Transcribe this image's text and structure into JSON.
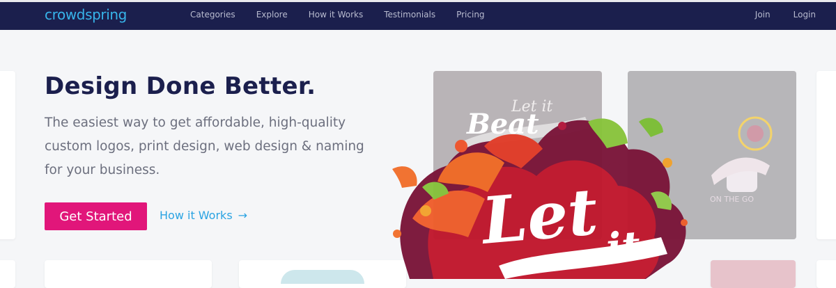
{
  "header": {
    "logo": "crowdspring",
    "nav": [
      "Categories",
      "Explore",
      "How it Works",
      "Testimonials",
      "Pricing"
    ],
    "join": "Join",
    "login": "Login"
  },
  "hero": {
    "title": "Design Done Better.",
    "subtitle": "The easiest way to get affordable, high-quality custom logos, print design, web design & naming for your business.",
    "cta": "Get Started",
    "secondary_link": "How it Works",
    "secondary_icon": "arrow-right-icon"
  },
  "gallery": {
    "artwork_text_1": "Let it",
    "artwork_text_2": "Beat",
    "featured_text_1": "Let",
    "featured_text_2": "it"
  },
  "colors": {
    "nav_bg": "#1b1f4d",
    "brand_blue": "#37b4ea",
    "cta": "#e1167a",
    "link": "#2aa3e2"
  }
}
